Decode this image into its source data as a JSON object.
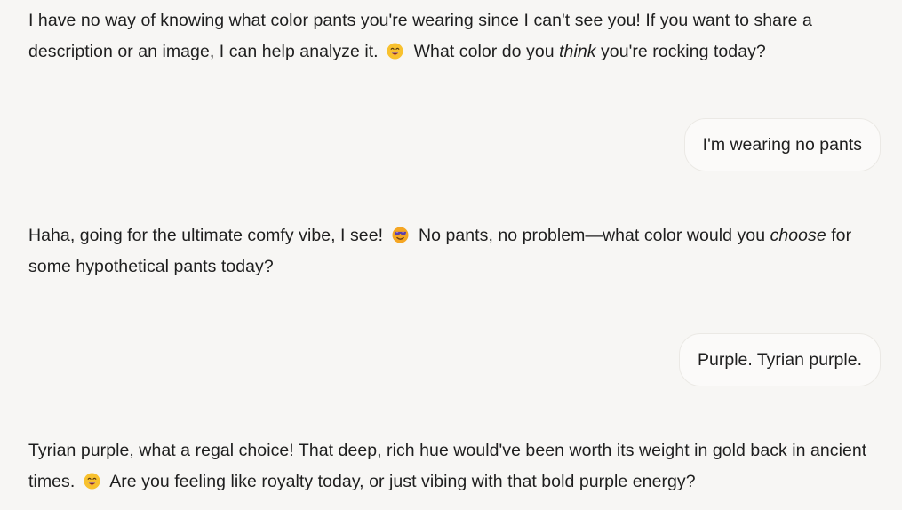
{
  "messages": [
    {
      "role": "assistant",
      "part1": "I have no way of knowing what color pants you're wearing since I can't see you! If you want to share a description or an image, I can help analyze it.",
      "emoji": "grinning-face-icon",
      "part2": "What color do you",
      "emph": "think",
      "part3": "you're rocking today?"
    },
    {
      "role": "user",
      "text": "I'm wearing no pants"
    },
    {
      "role": "assistant",
      "part1": "Haha, going for the ultimate comfy vibe, I see!",
      "emoji": "sunglasses-face-icon",
      "part2": "No pants, no problem—what color would you",
      "emph": "choose",
      "part3": "for some hypothetical pants today?"
    },
    {
      "role": "user",
      "text": "Purple. Tyrian purple."
    },
    {
      "role": "assistant",
      "part1": "Tyrian purple, what a regal choice! That deep, rich hue would've been worth its weight in gold back in ancient times.",
      "emoji": "grinning-face-icon",
      "part2": "Are you feeling like royalty today, or just vibing with that bold purple energy?"
    }
  ],
  "colors": {
    "background": "#f7f6f4",
    "bubble": "#fbfaf9",
    "text": "#1e1e1e",
    "emoji_face": "#f8c12e",
    "sunglasses": "#5b3fa8"
  }
}
